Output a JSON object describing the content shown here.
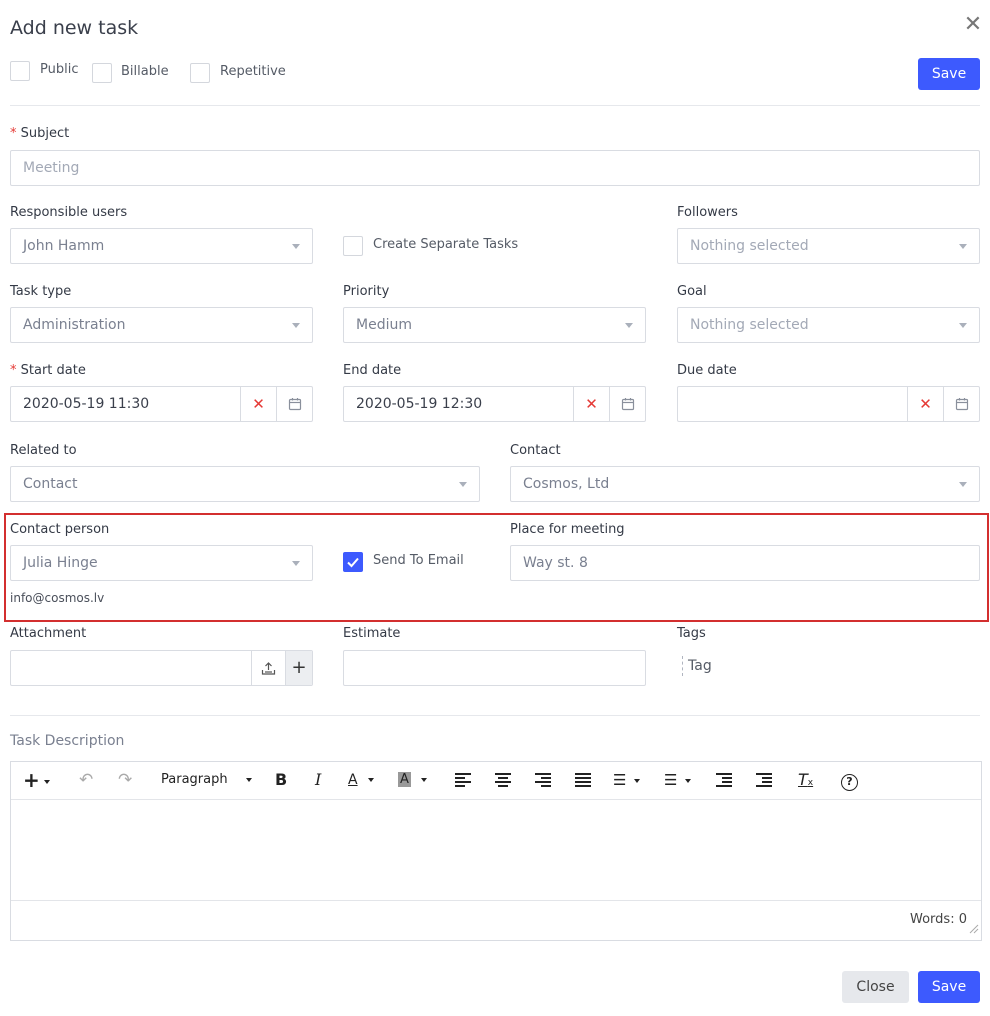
{
  "dialog": {
    "title": "Add new task"
  },
  "options": {
    "public": "Public",
    "billable": "Billable",
    "repetitive": "Repetitive"
  },
  "buttons": {
    "save": "Save",
    "close": "Close"
  },
  "subject": {
    "label": "Subject",
    "placeholder": "Meeting"
  },
  "responsible": {
    "label": "Responsible users",
    "value": "John Hamm"
  },
  "separate_tasks": {
    "label": "Create Separate Tasks"
  },
  "followers": {
    "label": "Followers",
    "value": "Nothing selected"
  },
  "task_type": {
    "label": "Task type",
    "value": "Administration"
  },
  "priority": {
    "label": "Priority",
    "value": "Medium"
  },
  "goal": {
    "label": "Goal",
    "value": "Nothing selected"
  },
  "start_date": {
    "label": "Start date",
    "value": "2020-05-19 11:30"
  },
  "end_date": {
    "label": "End date",
    "value": "2020-05-19 12:30"
  },
  "due_date": {
    "label": "Due date",
    "value": ""
  },
  "related_to": {
    "label": "Related to",
    "value": "Contact"
  },
  "contact": {
    "label": "Contact",
    "value": "Cosmos, Ltd"
  },
  "contact_person": {
    "label": "Contact person",
    "value": "Julia Hinge",
    "email": "info@cosmos.lv"
  },
  "send_to_email": {
    "label": "Send To Email",
    "checked": true
  },
  "place": {
    "label": "Place for meeting",
    "value": "Way st. 8"
  },
  "attachment": {
    "label": "Attachment"
  },
  "estimate": {
    "label": "Estimate"
  },
  "tags": {
    "label": "Tags",
    "placeholder": "Tag"
  },
  "description": {
    "label": "Task Description",
    "paragraph": "Paragraph",
    "words": "Words: 0"
  },
  "highlight_color": "#d32f2f",
  "accent_color": "#3d5afe"
}
